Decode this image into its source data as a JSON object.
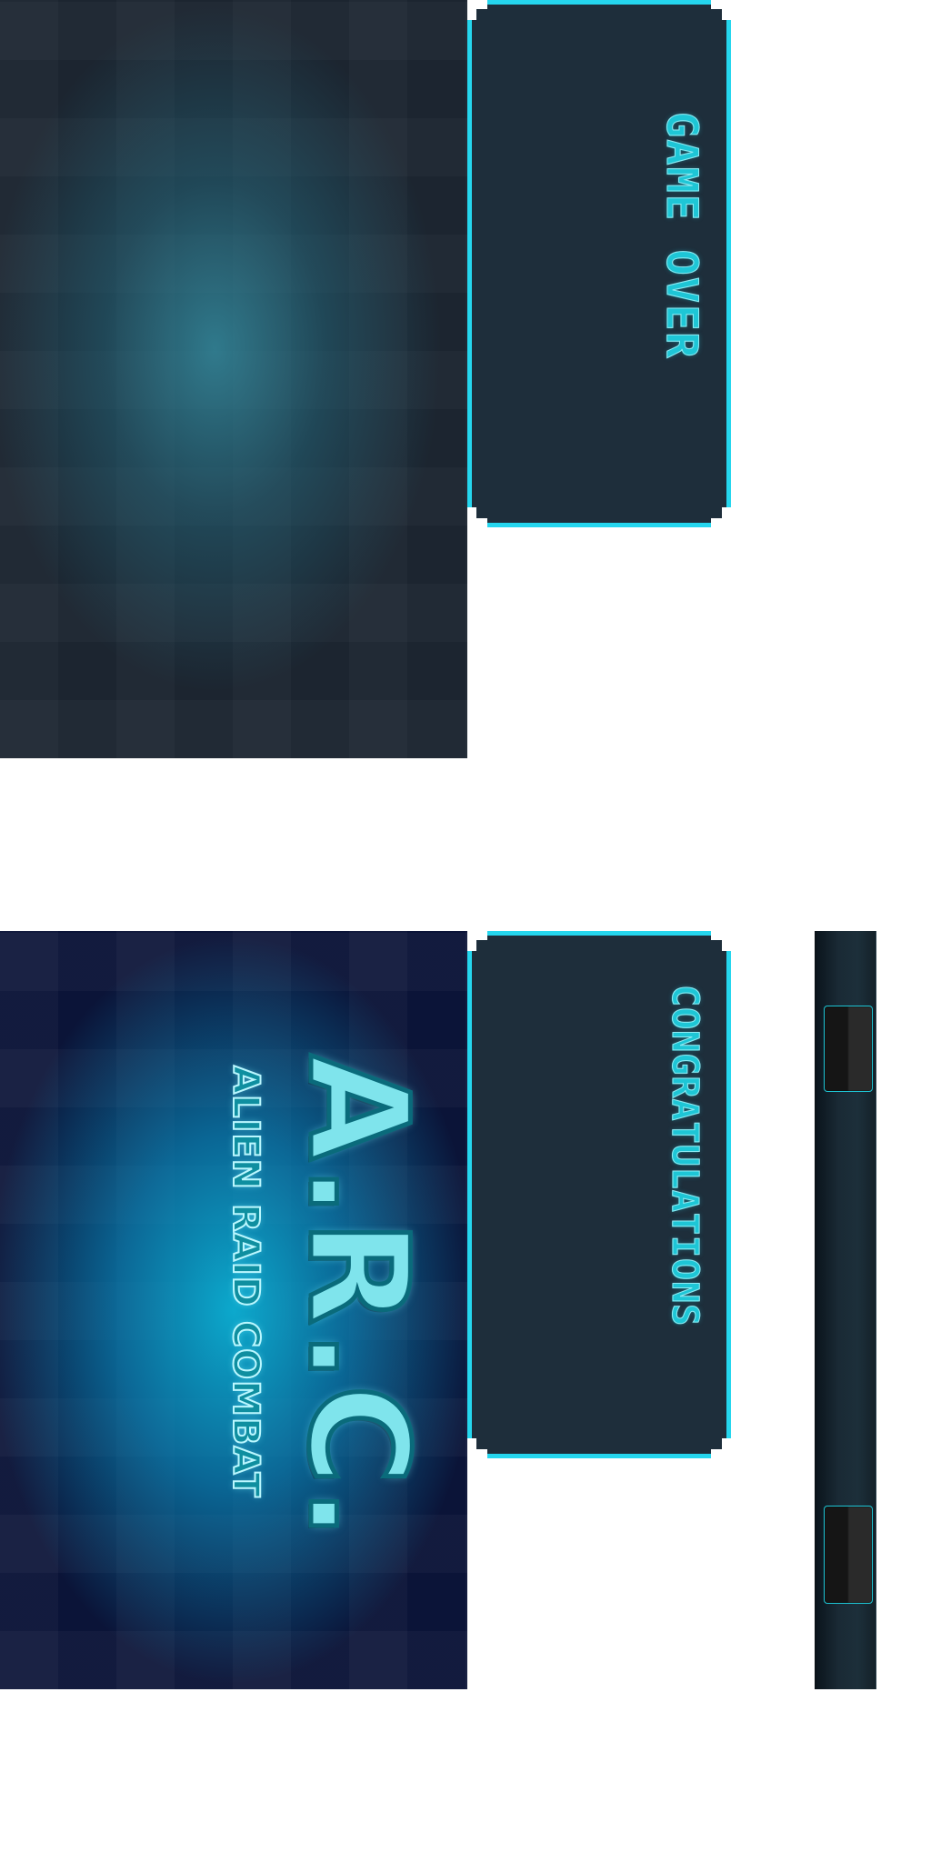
{
  "panels": {
    "game_over": {
      "title": "GAME OVER"
    },
    "congrats": {
      "title": "CONGRATULATIONS"
    }
  },
  "logo": {
    "main": "A.R.C.",
    "sub": "ALIEN RAID COMBAT"
  },
  "colors": {
    "accent": "#25D6EE",
    "panel_fill": "#1E2E3B",
    "dark_bg": "#1C2530",
    "blue_bg": "#0B1438"
  }
}
